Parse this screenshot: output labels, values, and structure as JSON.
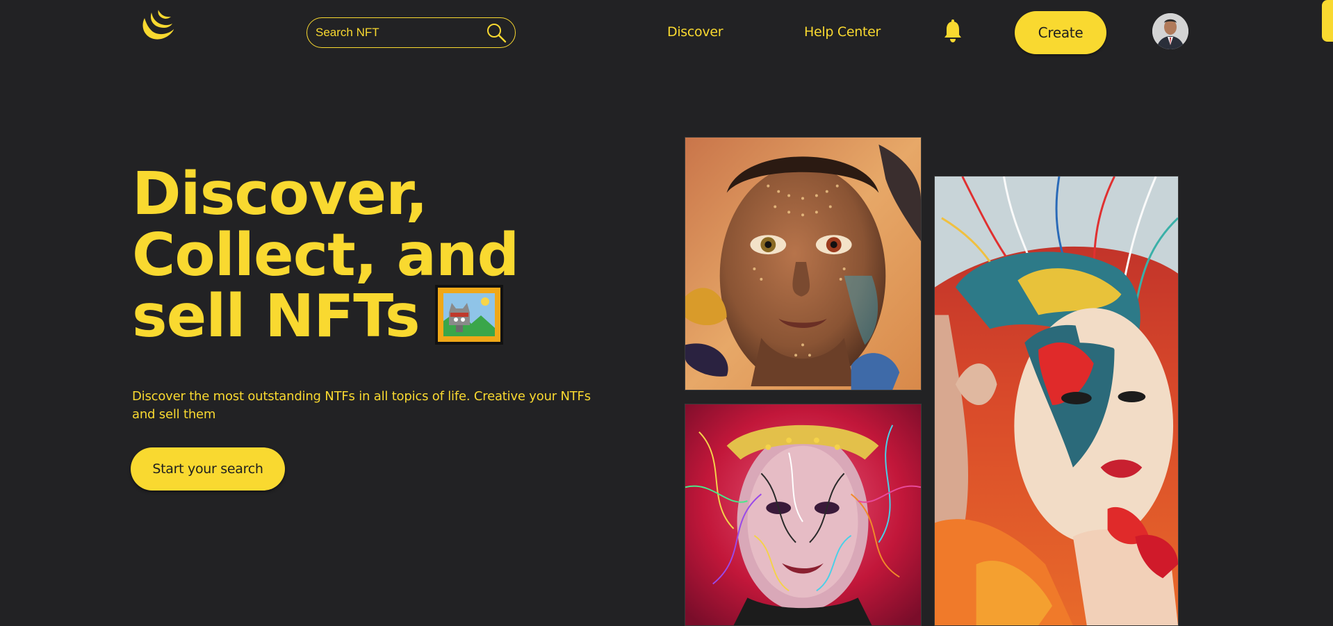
{
  "header": {
    "logo_icon": "crescent-logo-icon",
    "search": {
      "placeholder": "Search NFT",
      "icon": "search-icon"
    },
    "nav": {
      "discover_label": "Discover",
      "help_label": "Help Center"
    },
    "notification_icon": "bell-icon",
    "create_label": "Create",
    "avatar_icon": "user-avatar"
  },
  "hero": {
    "title_line1": "Discover,",
    "title_line2": "Collect, and",
    "title_line3": "sell NFTs",
    "title_icon": "framed-picture-icon",
    "description": "Discover the most outstanding NTFs in all topics of life. Creative your NTFs and sell them",
    "cta_label": "Start your search"
  },
  "gallery": {
    "items": [
      "nft-artwork-face-dots",
      "nft-artwork-colorful-portrait",
      "nft-artwork-painted-woman"
    ]
  },
  "colors": {
    "background": "#222224",
    "accent": "#f9d930",
    "button_text": "#1f1f1f"
  }
}
